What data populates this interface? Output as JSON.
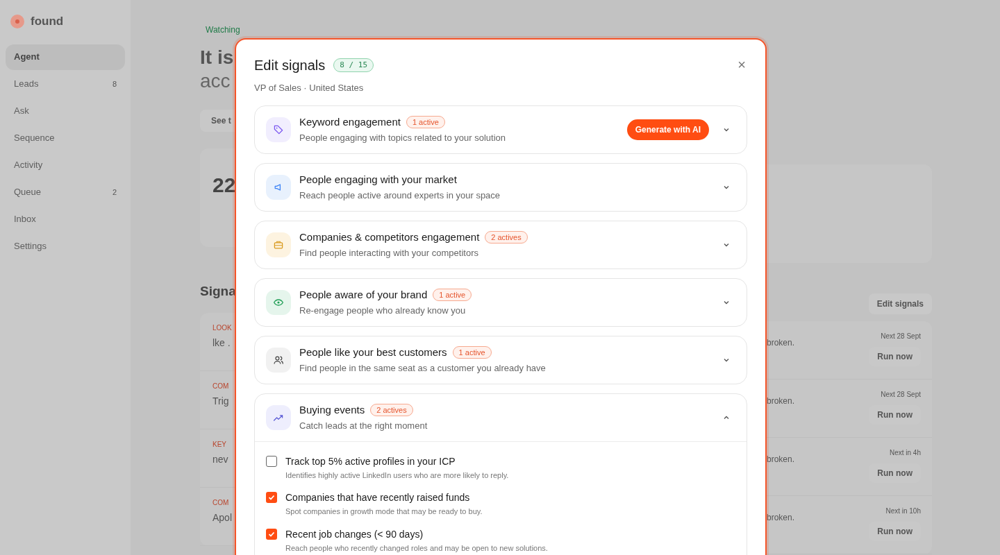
{
  "sidebar": {
    "logo": "found",
    "items": [
      {
        "label": "Agent",
        "selected": true
      },
      {
        "label": "Leads",
        "count": "8",
        "selected": false
      },
      {
        "label": "Ask",
        "selected": false
      },
      {
        "label": "Sequence",
        "selected": false
      },
      {
        "label": "Activity",
        "selected": false
      },
      {
        "label": "Queue",
        "count": "2",
        "selected": false
      },
      {
        "label": "Inbox",
        "selected": false
      },
      {
        "label": "Settings",
        "selected": false
      }
    ]
  },
  "background": {
    "status": "Watching",
    "headline": [
      "It is",
      "acc"
    ],
    "button": "See t",
    "stat_value": "22",
    "section_title": "Signa",
    "edit_button": "Edit signals",
    "rows": [
      {
        "tag": "LOOK",
        "text": "lke .",
        "note": "broken.",
        "next": "Next 28 Sept",
        "action": "Run now"
      },
      {
        "tag": "COM",
        "text": "Trig",
        "note": "broken.",
        "next": "Next 28 Sept",
        "action": "Run now"
      },
      {
        "tag": "KEY",
        "text": "nev",
        "note": "broken.",
        "next": "Next in 4h",
        "action": "Run now"
      },
      {
        "tag": "COM",
        "text": "Apol",
        "note": "broken.",
        "next": "Next in 10h",
        "action": "Run now"
      }
    ]
  },
  "modal": {
    "title": "Edit signals",
    "count": "8 / 15",
    "subtitle": "VP of Sales · United States",
    "close": "×",
    "sections": [
      {
        "title": "Keyword engagement",
        "badge": "1 active",
        "description": "People engaging with topics related to your solution",
        "button": "Generate with AI",
        "expanded": false
      },
      {
        "title": "People engaging with your market",
        "description": "Reach people active around experts in your space",
        "expanded": false
      },
      {
        "title": "Companies & competitors engagement",
        "badge": "2 actives",
        "description": "Find people interacting with your competitors",
        "expanded": false
      },
      {
        "title": "People aware of your brand",
        "badge": "1 active",
        "description": "Re-engage people who already know you",
        "expanded": false
      },
      {
        "title": "People like your best customers",
        "badge": "1 active",
        "description": "Find people in the same seat as a customer you already have",
        "expanded": false
      },
      {
        "title": "Buying events",
        "badge": "2 actives",
        "description": "Catch leads at the right moment",
        "expanded": true,
        "options": [
          {
            "label": "Track top 5% active profiles in your ICP",
            "description": "Identifies highly active LinkedIn users who are more likely to reply.",
            "checked": false
          },
          {
            "label": "Companies that have recently raised funds",
            "description": "Spot companies in growth mode that may be ready to buy.",
            "checked": true
          },
          {
            "label": "Recent job changes (< 90 days)",
            "description": "Reach people who recently changed roles and may be open to new solutions.",
            "checked": true
          }
        ]
      }
    ]
  }
}
